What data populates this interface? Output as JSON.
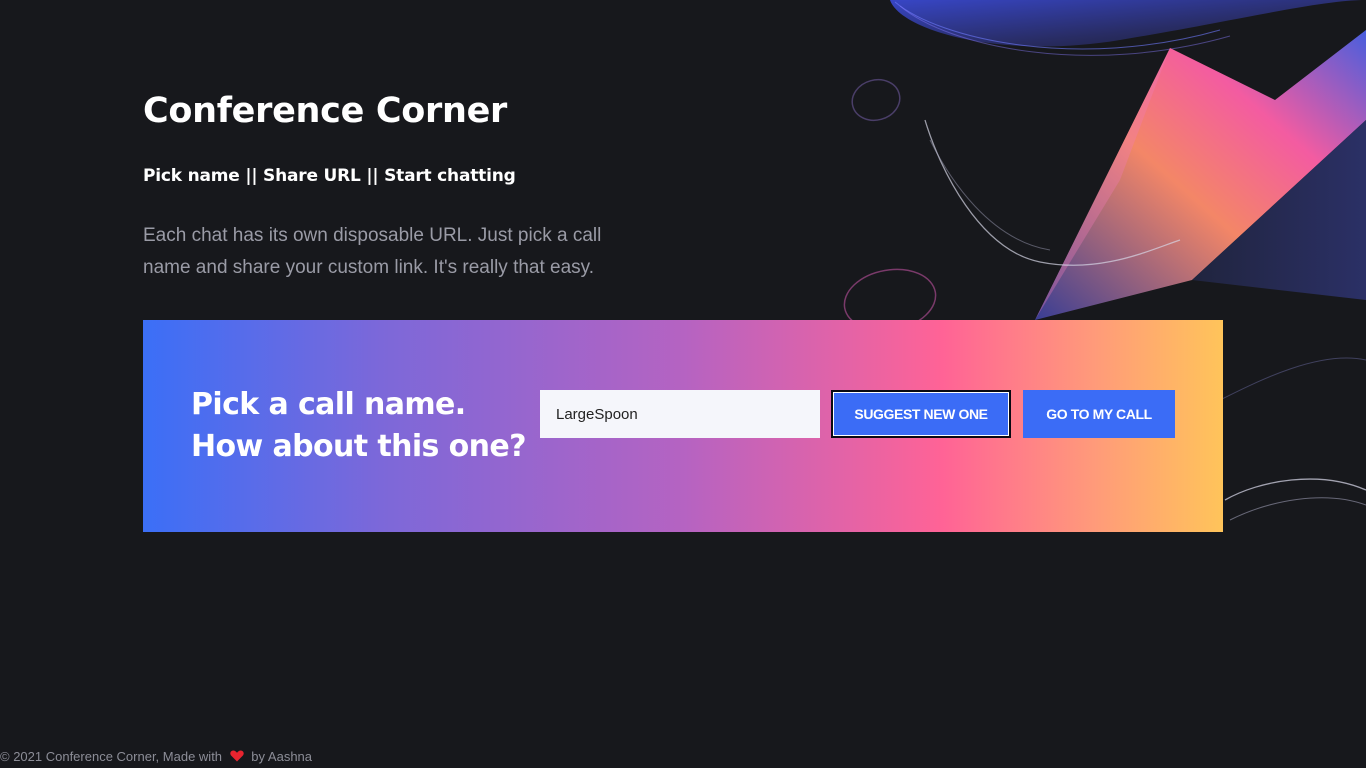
{
  "app": {
    "title": "Conference Corner",
    "tagline": "Pick name || Share URL || Start chatting",
    "description": "Each chat has its own disposable URL. Just pick a call name and share your custom link. It's really that easy."
  },
  "cta": {
    "heading_line1": "Pick a call name.",
    "heading_line2": "How about this one?",
    "input_value": "LargeSpoon",
    "suggest_label": "SUGGEST NEW ONE",
    "go_label": "GO TO MY CALL"
  },
  "footer": {
    "prefix": "© 2021 Conference Corner, Made with",
    "heart_icon": "heart-icon",
    "suffix": "by Aashna"
  },
  "colors": {
    "background": "#17181c",
    "accent_blue": "#3b6cf6",
    "gradient_start": "#3b6ff7",
    "gradient_mid": "#ff6396",
    "gradient_end": "#ffc45a",
    "heart": "#e8242f"
  }
}
